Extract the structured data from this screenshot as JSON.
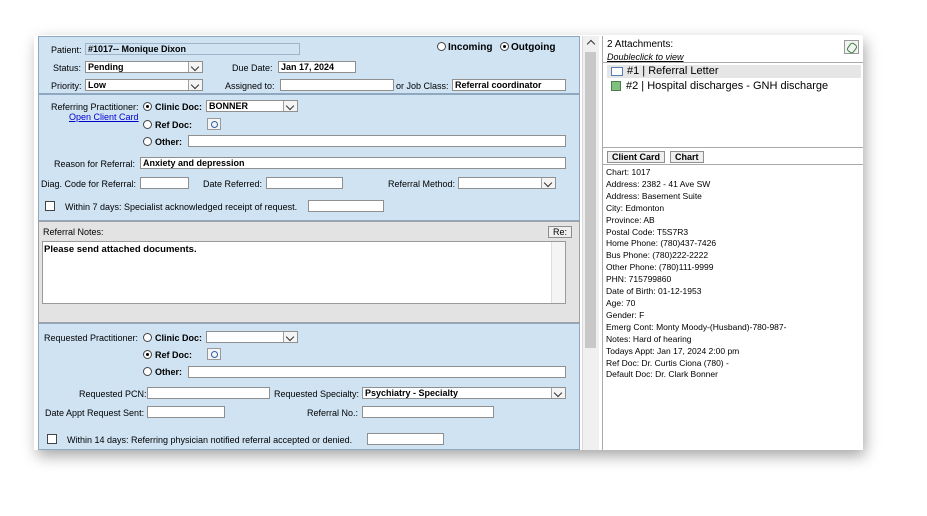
{
  "header": {
    "patient_label": "Patient:",
    "patient_value": "#1017-- Monique Dixon",
    "incoming_label": "Incoming",
    "outgoing_label": "Outgoing",
    "status_label": "Status:",
    "status_value": "Pending",
    "due_label": "Due Date:",
    "due_value": "Jan 17, 2024",
    "priority_label": "Priority:",
    "priority_value": "Low",
    "assigned_label": "Assigned to:",
    "assigned_value": "",
    "jobclass_label": "or Job Class:",
    "jobclass_value": "Referral coordinator"
  },
  "referring": {
    "label": "Referring Practitioner:",
    "open_card": "Open Client Card",
    "clinic_doc_label": "Clinic Doc:",
    "clinic_doc_value": "BONNER",
    "ref_doc_label": "Ref Doc:",
    "other_label": "Other:",
    "reason_label": "Reason for Referral:",
    "reason_value": "Anxiety and depression",
    "diag_label": "Diag. Code for Referral:",
    "date_ref_label": "Date Referred:",
    "method_label": "Referral Method:",
    "within7": "Within 7 days: Specialist acknowledged receipt of request."
  },
  "notes": {
    "label": "Referral Notes:",
    "re_button": "Re:",
    "text": "Please send attached documents."
  },
  "requested": {
    "label": "Requested Practitioner:",
    "clinic_doc_label": "Clinic Doc:",
    "ref_doc_label": "Ref Doc:",
    "other_label": "Other:",
    "pcn_label": "Requested PCN:",
    "specialty_label": "Requested Specialty:",
    "specialty_value": "Psychiatry - Specialty",
    "appt_label": "Date Appt Request Sent:",
    "refno_label": "Referral No.:",
    "within14": "Within 14 days: Referring physician notified referral accepted or denied."
  },
  "attachments": {
    "title": "2 Attachments:",
    "hint": "Doubleclick to view",
    "items": [
      "#1 | Referral Letter",
      "#2 | Hospital discharges - GNH discharge"
    ]
  },
  "client_card": {
    "tab1": "Client Card",
    "tab2": "Chart",
    "lines": [
      "Chart: 1017",
      "Address: 2382 - 41 Ave SW",
      "Address: Basement Suite",
      "City: Edmonton",
      "Province: AB",
      "Postal Code: T5S7R3",
      "Home Phone: (780)437-7426",
      "Bus Phone: (780)222-2222",
      "Other Phone: (780)111-9999",
      "PHN: 715799860",
      "Date of Birth: 01-12-1953",
      "Age: 70",
      "Gender: F",
      "Emerg Cont: Monty Moody-(Husband)-780-987-",
      "Notes: Hard of hearing",
      "Todays Appt: Jan 17, 2024 2:00 pm",
      "Ref Doc: Dr. Curtis Ciona (780)  -",
      "Default Doc: Dr. Clark Bonner"
    ]
  },
  "colors": {
    "panel_bg": "#cfe3f3",
    "link": "#0000cc"
  }
}
